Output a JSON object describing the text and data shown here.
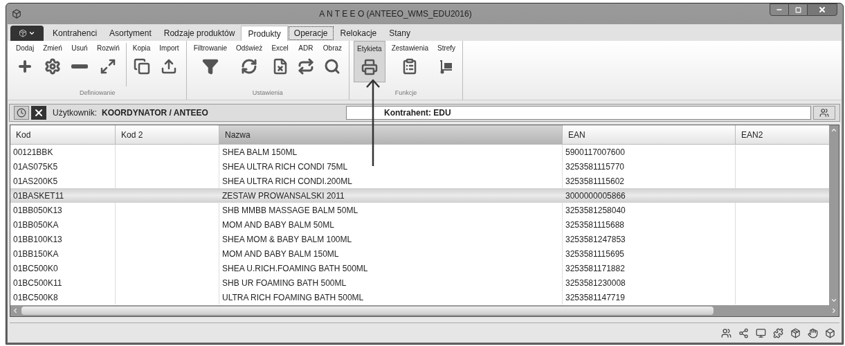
{
  "window": {
    "title": "A N T E E O (ANTEEO_WMS_EDU2016)"
  },
  "tabs": [
    {
      "label": "Kontrahenci",
      "selected": false,
      "focused": false
    },
    {
      "label": "Asortyment",
      "selected": false,
      "focused": false
    },
    {
      "label": "Rodzaje produktów",
      "selected": false,
      "focused": false
    },
    {
      "label": "Produkty",
      "selected": true,
      "focused": false
    },
    {
      "label": "Operacje",
      "selected": false,
      "focused": true
    },
    {
      "label": "Relokacje",
      "selected": false,
      "focused": false
    },
    {
      "label": "Stany",
      "selected": false,
      "focused": false
    }
  ],
  "ribbon": {
    "groups": [
      {
        "label": "Definiowanie",
        "buttons": [
          {
            "label": "Dodaj",
            "selected": false
          },
          {
            "label": "Zmień",
            "selected": false
          },
          {
            "label": "Usuń",
            "selected": false
          },
          {
            "label": "Rozwiń",
            "selected": false
          },
          {
            "label": "Kopia",
            "selected": false
          },
          {
            "label": "Import",
            "selected": false
          }
        ]
      },
      {
        "label": "Ustawienia",
        "buttons": [
          {
            "label": "Filtrowanie",
            "selected": false
          },
          {
            "label": "Odśwież",
            "selected": false
          },
          {
            "label": "Excel",
            "selected": false
          },
          {
            "label": "ADR",
            "selected": false
          },
          {
            "label": "Obraz",
            "selected": false
          }
        ]
      },
      {
        "label": "Funkcje",
        "buttons": [
          {
            "label": "Etykieta",
            "selected": true
          },
          {
            "label": "Zestawienia",
            "selected": false
          },
          {
            "label": "Strefy",
            "selected": false
          }
        ]
      }
    ]
  },
  "user_bar": {
    "user_label": "Użytkownik:",
    "user_value": "KOORDYNATOR / ANTEEO",
    "contractor": "Kontrahent: EDU"
  },
  "table": {
    "columns": [
      {
        "label": "Kod",
        "sorted": false
      },
      {
        "label": "Kod 2",
        "sorted": false
      },
      {
        "label": "Nazwa",
        "sorted": true
      },
      {
        "label": "EAN",
        "sorted": false
      },
      {
        "label": "EAN2",
        "sorted": false
      }
    ],
    "rows": [
      {
        "cells": [
          "00121BBK",
          "",
          "SHEA BALM 150ML",
          "5900117007600",
          ""
        ],
        "selected": false
      },
      {
        "cells": [
          "01AS075K5",
          "",
          "SHEA ULTRA RICH CONDI 75ML",
          "3253581115770",
          ""
        ],
        "selected": false
      },
      {
        "cells": [
          "01AS200K5",
          "",
          "SHEA ULTRA RICH CONDI.200ML",
          "3253581115602",
          ""
        ],
        "selected": false
      },
      {
        "cells": [
          "01BASKET11",
          "",
          "ZESTAW PROWANSALSKI 2011",
          "3000000005866",
          ""
        ],
        "selected": true
      },
      {
        "cells": [
          "01BB050K13",
          "",
          "SHB MMBB MASSAGE BALM 50ML",
          "3253581258040",
          ""
        ],
        "selected": false
      },
      {
        "cells": [
          "01BB050KA",
          "",
          "MOM AND BABY BALM 50ML",
          "3253581115688",
          ""
        ],
        "selected": false
      },
      {
        "cells": [
          "01BB100K13",
          "",
          "SHEA MOM & BABY BALM 100ML",
          "3253581247853",
          ""
        ],
        "selected": false
      },
      {
        "cells": [
          "01BB150KA",
          "",
          "MOM AND BABY BALM 150ML",
          "3253581115695",
          ""
        ],
        "selected": false
      },
      {
        "cells": [
          "01BC500K0",
          "",
          "SHEA U.RICH.FOAMING BATH 500ML",
          "3253581171882",
          ""
        ],
        "selected": false
      },
      {
        "cells": [
          "01BC500K11",
          "",
          "SHB UR FOAMING BATH 500ML",
          "3253581230008",
          ""
        ],
        "selected": false
      },
      {
        "cells": [
          "01BC500K8",
          "",
          "ULTRA RICH FOAMING BATH 500ML",
          "3253581147719",
          ""
        ],
        "selected": false
      }
    ]
  }
}
